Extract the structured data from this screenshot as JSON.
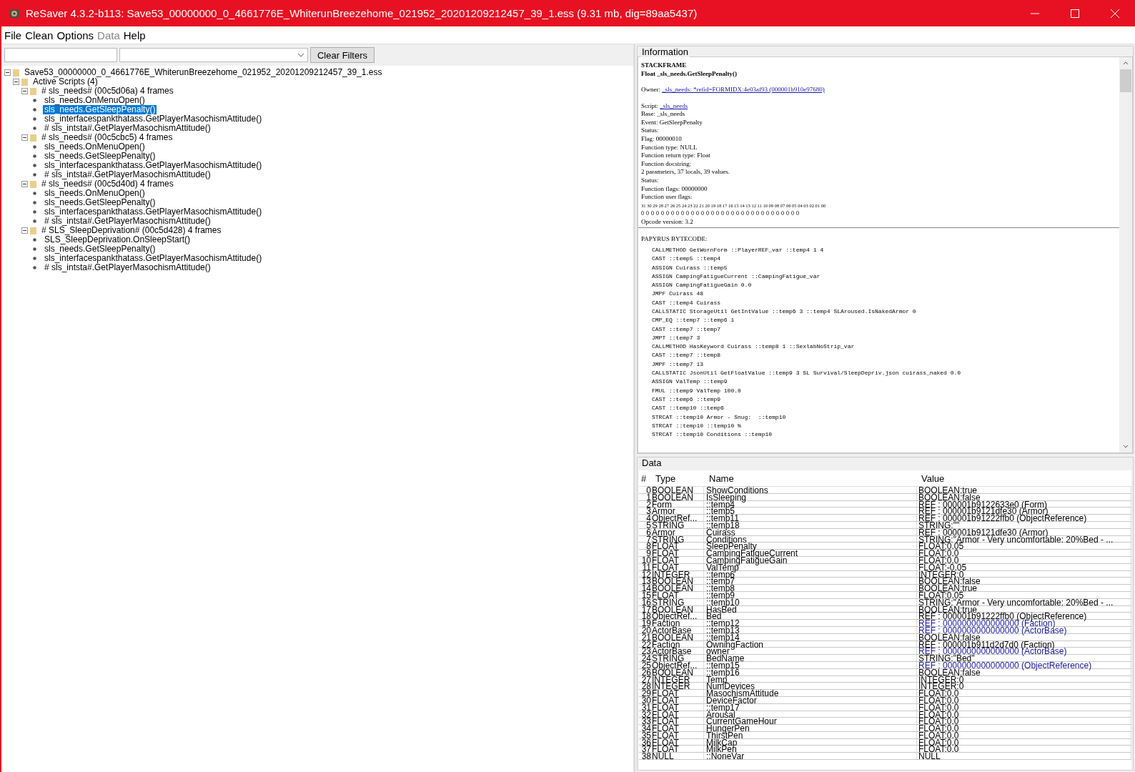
{
  "window": {
    "title": "ReSaver 4.3.2-b113: Save53_00000000_0_4661776E_WhiterunBreezehome_021952_20201209212457_39_1.ess (9.31 mb, dig=89aa5437)"
  },
  "menu": [
    {
      "label": "File",
      "disabled": false
    },
    {
      "label": "Clean",
      "disabled": false
    },
    {
      "label": "Options",
      "disabled": false
    },
    {
      "label": "Data",
      "disabled": true
    },
    {
      "label": "Help",
      "disabled": false
    }
  ],
  "filters": {
    "button": "Clear Filters"
  },
  "tree": [
    {
      "label": "Save53_00000000_0_4661776E_WhiterunBreezehome_021952_20201209212457_39_1.ess",
      "kind": "folder",
      "expanded": true,
      "selected": false,
      "children": [
        {
          "label": "Active Scripts (4)",
          "kind": "folder",
          "expanded": true,
          "selected": false,
          "children": [
            {
              "label": "# sls_needs# (00c5d06a) 4 frames",
              "kind": "folder",
              "expanded": true,
              "selected": false,
              "children": [
                {
                  "label": "sls_needs.OnMenuOpen()",
                  "kind": "frame",
                  "selected": false
                },
                {
                  "label": "sls_needs.GetSleepPenalty()",
                  "kind": "frame",
                  "selected": true
                },
                {
                  "label": "sls_interfacespankthatass.GetPlayerMasochismAttitude()",
                  "kind": "frame",
                  "selected": false
                },
                {
                  "label": "# sls_intsta#.GetPlayerMasochismAttitude()",
                  "kind": "frame",
                  "selected": false
                }
              ]
            },
            {
              "label": "# sls_needs# (00c5cbc5) 4 frames",
              "kind": "folder",
              "expanded": true,
              "selected": false,
              "children": [
                {
                  "label": "sls_needs.OnMenuOpen()",
                  "kind": "frame",
                  "selected": false
                },
                {
                  "label": "sls_needs.GetSleepPenalty()",
                  "kind": "frame",
                  "selected": false
                },
                {
                  "label": "sls_interfacespankthatass.GetPlayerMasochismAttitude()",
                  "kind": "frame",
                  "selected": false
                },
                {
                  "label": "# sls_intsta#.GetPlayerMasochismAttitude()",
                  "kind": "frame",
                  "selected": false
                }
              ]
            },
            {
              "label": "# sls_needs# (00c5d40d) 4 frames",
              "kind": "folder",
              "expanded": true,
              "selected": false,
              "children": [
                {
                  "label": "sls_needs.OnMenuOpen()",
                  "kind": "frame",
                  "selected": false
                },
                {
                  "label": "sls_needs.GetSleepPenalty()",
                  "kind": "frame",
                  "selected": false
                },
                {
                  "label": "sls_interfacespankthatass.GetPlayerMasochismAttitude()",
                  "kind": "frame",
                  "selected": false
                },
                {
                  "label": "# sls_intsta#.GetPlayerMasochismAttitude()",
                  "kind": "frame",
                  "selected": false
                }
              ]
            },
            {
              "label": "# SLS_SleepDeprivation# (00c5d428) 4 frames",
              "kind": "folder",
              "expanded": true,
              "selected": false,
              "children": [
                {
                  "label": "SLS_SleepDeprivation.OnSleepStart()",
                  "kind": "frame",
                  "selected": false
                },
                {
                  "label": "sls_needs.GetSleepPenalty()",
                  "kind": "frame",
                  "selected": false
                },
                {
                  "label": "sls_interfacespankthatass.GetPlayerMasochismAttitude()",
                  "kind": "frame",
                  "selected": false
                },
                {
                  "label": "# sls_intsta#.GetPlayerMasochismAttitude()",
                  "kind": "frame",
                  "selected": false
                }
              ]
            }
          ]
        }
      ]
    }
  ],
  "information": {
    "title": "Information",
    "heading": [
      "STACKFRAME",
      "Float _sls_needs.GetSleepPenalty()"
    ],
    "sections": [
      [
        {
          "label": "Owner:",
          "link": "_sls_needs: *refid=FORMIDX:4e03af93 (000001b910e97680)"
        }
      ],
      [
        {
          "label": "Script:",
          "link": "_sls_needs"
        },
        {
          "label": "Base: _sls_needs"
        },
        {
          "label": "Event: GetSleepPenalty"
        },
        {
          "label": "Status:"
        },
        {
          "label": "Flag: 00000010"
        },
        {
          "label": "Function type: NULL"
        },
        {
          "label": "Function return type: Float"
        },
        {
          "label": "Function docstring:"
        },
        {
          "label": "2 parameters, 37 locals, 39 values."
        },
        {
          "label": "Status:"
        },
        {
          "label": "Function flags: 00000000"
        },
        {
          "label": "Function user flags:"
        }
      ]
    ],
    "bit_labels": "31 30 29 28 27 26 25 24 23 22 21 20 19 18 17 16 15 14 13 12 11 10 09 08 07 06 05 04 03 02 01 00",
    "bits": "0 0 0 0 0 0 0 0 0 0 0 0 0 0 0 0 0 0 0 0 0 0 0 0 0 0 0 0 0 0 0 0",
    "opcode": "Opcode version: 3.2",
    "bytecode_title": "PAPYRUS BYTECODE:",
    "bytecode": [
      "CALLMETHOD GetWornForm ::PlayerREF_var ::temp4 1 4",
      "CAST ::temp5 ::temp4",
      "ASSIGN Cuirass ::temp5",
      "ASSIGN CampingFatigueCurrent ::CampingFatigue_var",
      "ASSIGN CampingFatigueGain 0.0",
      "JMPF Cuirass 48",
      "CAST ::temp4 Cuirass",
      "CALLSTATIC StorageUtil GetIntValue ::temp6 3 ::temp4 SLAroused.IsNakedArmor 0",
      "CMP_EQ ::temp7 ::temp6 1",
      "CAST ::temp7 ::temp7",
      "JMPT ::temp7 3",
      "CALLMETHOD HasKeyword Cuirass ::temp8 1 ::SexlabNoStrip_var",
      "CAST ::temp7 ::temp8",
      "JMPF ::temp7 13",
      "CALLSTATIC JsonUtil GetFloatValue ::temp9 3 SL Survival/SleepDepriv.json cuirass_naked 0.0",
      "ASSIGN ValTemp ::temp9",
      "FMUL ::temp9 ValTemp 100.0",
      "CAST ::temp6 ::temp9",
      "CAST ::temp10 ::temp6",
      "STRCAT ::temp10 Armor - Snug:  ::temp10",
      "STRCAT ::temp10 ::temp10 %",
      "STRCAT ::temp10 Conditions ::temp10"
    ]
  },
  "data": {
    "title": "Data",
    "columns": [
      "#",
      "Type",
      "Name",
      "Value"
    ],
    "rows": [
      {
        "n": "0",
        "type": "BOOLEAN",
        "name": "ShowConditions",
        "value": "BOOLEAN:true",
        "linked": false
      },
      {
        "n": "1",
        "type": "BOOLEAN",
        "name": "IsSleeping",
        "value": "BOOLEAN:false",
        "linked": false
      },
      {
        "n": "2",
        "type": "Form",
        "name": "::temp4",
        "value": "REF : 000001b9122633e0 (Form)",
        "linked": false
      },
      {
        "n": "3",
        "type": "Armor",
        "name": "::temp5",
        "value": "REF : 000001b9121dfe30 (Armor)",
        "linked": false
      },
      {
        "n": "4",
        "type": "ObjectRef...",
        "name": "::temp11",
        "value": "REF : 000001b91222ffb0 (ObjectReference)",
        "linked": false
      },
      {
        "n": "5",
        "type": "STRING",
        "name": "::temp18",
        "value": "STRING:\"\"",
        "linked": false
      },
      {
        "n": "6",
        "type": "Armor",
        "name": "Cuirass",
        "value": "REF : 000001b9121dfe30 (Armor)",
        "linked": false
      },
      {
        "n": "7",
        "type": "STRING",
        "name": "Conditions",
        "value": "STRING:\"Armor - Very uncomfortable: 20%Bed - ...",
        "linked": false
      },
      {
        "n": "8",
        "type": "FLOAT",
        "name": "SleepPenalty",
        "value": "FLOAT:0.05",
        "linked": false
      },
      {
        "n": "9",
        "type": "FLOAT",
        "name": "CampingFatigueCurrent",
        "value": "FLOAT:0.0",
        "linked": false
      },
      {
        "n": "10",
        "type": "FLOAT",
        "name": "CampingFatigueGain",
        "value": "FLOAT:0.0",
        "linked": false
      },
      {
        "n": "11",
        "type": "FLOAT",
        "name": "ValTemp",
        "value": "FLOAT:-0.05",
        "linked": false
      },
      {
        "n": "12",
        "type": "INTEGER",
        "name": "::temp6",
        "value": "INTEGER:0",
        "linked": false
      },
      {
        "n": "13",
        "type": "BOOLEAN",
        "name": "::temp7",
        "value": "BOOLEAN:false",
        "linked": false
      },
      {
        "n": "14",
        "type": "BOOLEAN",
        "name": "::temp8",
        "value": "BOOLEAN:true",
        "linked": false
      },
      {
        "n": "15",
        "type": "FLOAT",
        "name": "::temp9",
        "value": "FLOAT:0.05",
        "linked": false
      },
      {
        "n": "16",
        "type": "STRING",
        "name": "::temp10",
        "value": "STRING:\"Armor - Very uncomfortable: 20%Bed - ...",
        "linked": false
      },
      {
        "n": "17",
        "type": "BOOLEAN",
        "name": "HasBed",
        "value": "BOOLEAN:true",
        "linked": false
      },
      {
        "n": "18",
        "type": "ObjectRef...",
        "name": "Bed",
        "value": "REF : 000001b91222ffb0 (ObjectReference)",
        "linked": false
      },
      {
        "n": "19",
        "type": "Faction",
        "name": "::temp12",
        "value": "REF : 0000000000000000 (Faction)",
        "linked": true
      },
      {
        "n": "20",
        "type": "ActorBase",
        "name": "::temp13",
        "value": "REF : 0000000000000000 (ActorBase)",
        "linked": true
      },
      {
        "n": "21",
        "type": "BOOLEAN",
        "name": "::temp14",
        "value": "BOOLEAN:false",
        "linked": false
      },
      {
        "n": "22",
        "type": "Faction",
        "name": "OwningFaction",
        "value": "REF : 000001b911d2d7d0 (Faction)",
        "linked": false
      },
      {
        "n": "23",
        "type": "ActorBase",
        "name": "owner",
        "value": "REF : 0000000000000000 (ActorBase)",
        "linked": true
      },
      {
        "n": "24",
        "type": "STRING",
        "name": "BedName",
        "value": "STRING:\"Bed\"",
        "linked": false
      },
      {
        "n": "25",
        "type": "ObjectRef...",
        "name": "::temp15",
        "value": "REF : 0000000000000000 (ObjectReference)",
        "linked": true
      },
      {
        "n": "26",
        "type": "BOOLEAN",
        "name": "::temp16",
        "value": "BOOLEAN:false",
        "linked": false
      },
      {
        "n": "27",
        "type": "INTEGER",
        "name": "Temp",
        "value": "INTEGER:0",
        "linked": false
      },
      {
        "n": "28",
        "type": "INTEGER",
        "name": "NumDevices",
        "value": "INTEGER:0",
        "linked": false
      },
      {
        "n": "29",
        "type": "FLOAT",
        "name": "MasochismAttitude",
        "value": "FLOAT:0.0",
        "linked": false
      },
      {
        "n": "30",
        "type": "FLOAT",
        "name": "DeviceFactor",
        "value": "FLOAT:0.0",
        "linked": false
      },
      {
        "n": "31",
        "type": "FLOAT",
        "name": "::temp17",
        "value": "FLOAT:0.0",
        "linked": false
      },
      {
        "n": "32",
        "type": "FLOAT",
        "name": "Arousal",
        "value": "FLOAT:0.0",
        "linked": false
      },
      {
        "n": "33",
        "type": "FLOAT",
        "name": "CurrentGameHour",
        "value": "FLOAT:0.0",
        "linked": false
      },
      {
        "n": "34",
        "type": "FLOAT",
        "name": "HungerPen",
        "value": "FLOAT:0.0",
        "linked": false
      },
      {
        "n": "35",
        "type": "FLOAT",
        "name": "ThirstPen",
        "value": "FLOAT:0.0",
        "linked": false
      },
      {
        "n": "36",
        "type": "FLOAT",
        "name": "MilkCap",
        "value": "FLOAT:0.0",
        "linked": false
      },
      {
        "n": "37",
        "type": "FLOAT",
        "name": "MilkPen",
        "value": "FLOAT:0.0",
        "linked": false
      },
      {
        "n": "38",
        "type": "NULL",
        "name": "::NoneVar",
        "value": "NULL",
        "linked": false
      }
    ]
  }
}
